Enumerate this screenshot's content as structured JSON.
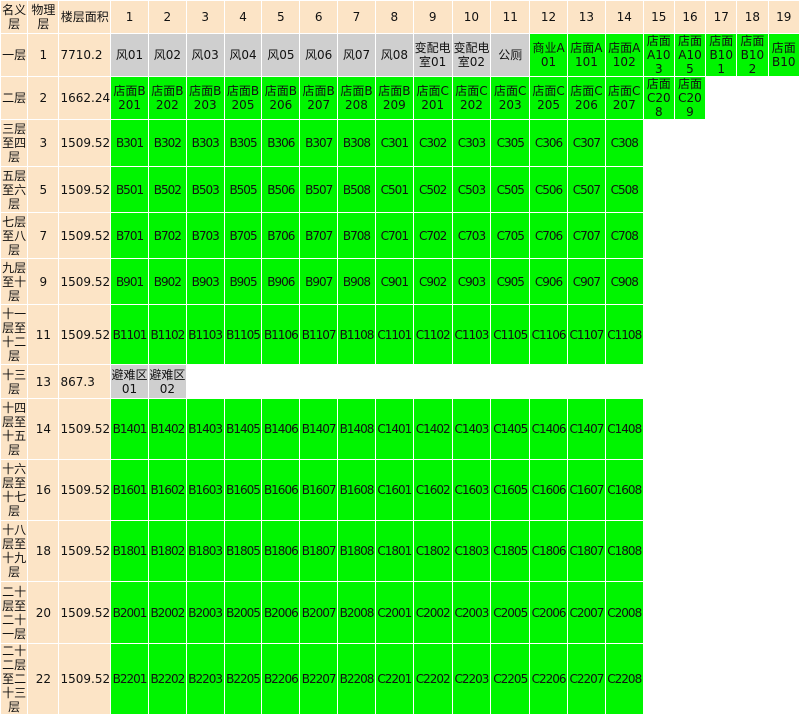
{
  "headers": {
    "c0": "名义层",
    "c1": "物理层",
    "c2": "楼层面积",
    "nums": [
      "1",
      "2",
      "3",
      "4",
      "5",
      "6",
      "7",
      "8",
      "9",
      "10",
      "11",
      "12",
      "13",
      "14",
      "15",
      "16",
      "17",
      "18",
      "19"
    ]
  },
  "rows": [
    {
      "name": "一层",
      "phys": "1",
      "area": "7710.2",
      "cells": [
        {
          "t": "风01",
          "c": "s"
        },
        {
          "t": "风02",
          "c": "s"
        },
        {
          "t": "风03",
          "c": "s"
        },
        {
          "t": "风04",
          "c": "s"
        },
        {
          "t": "风05",
          "c": "s"
        },
        {
          "t": "风06",
          "c": "s"
        },
        {
          "t": "风07",
          "c": "s"
        },
        {
          "t": "风08",
          "c": "s"
        },
        {
          "t": "变配电室01",
          "c": "s"
        },
        {
          "t": "变配电室02",
          "c": "s"
        },
        {
          "t": "公厕",
          "c": "s"
        },
        {
          "t": "商业A01",
          "c": "g"
        },
        {
          "t": "店面A101",
          "c": "g"
        },
        {
          "t": "店面A102",
          "c": "g"
        },
        {
          "t": "店面A103",
          "c": "g"
        },
        {
          "t": "店面A105",
          "c": "g"
        },
        {
          "t": "店面B101",
          "c": "g"
        },
        {
          "t": "店面B102",
          "c": "g"
        },
        {
          "t": "店面B10",
          "c": "g"
        }
      ]
    },
    {
      "name": "二层",
      "phys": "2",
      "area": "1662.24",
      "cells": [
        {
          "t": "店面B201",
          "c": "g"
        },
        {
          "t": "店面B202",
          "c": "g"
        },
        {
          "t": "店面B203",
          "c": "g"
        },
        {
          "t": "店面B205",
          "c": "g"
        },
        {
          "t": "店面B206",
          "c": "g"
        },
        {
          "t": "店面B207",
          "c": "g"
        },
        {
          "t": "店面B208",
          "c": "g"
        },
        {
          "t": "店面B209",
          "c": "g"
        },
        {
          "t": "店面C201",
          "c": "g"
        },
        {
          "t": "店面C202",
          "c": "g"
        },
        {
          "t": "店面C203",
          "c": "g"
        },
        {
          "t": "店面C205",
          "c": "g"
        },
        {
          "t": "店面C206",
          "c": "g"
        },
        {
          "t": "店面C207",
          "c": "g"
        },
        {
          "t": "店面C208",
          "c": "g"
        },
        {
          "t": "店面C209",
          "c": "g"
        },
        {
          "t": "",
          "c": "w"
        },
        {
          "t": "",
          "c": "w"
        },
        {
          "t": "",
          "c": "w"
        }
      ]
    },
    {
      "name": "三层至四层",
      "phys": "3",
      "area": "1509.52",
      "cells": [
        "B301",
        "B302",
        "B303",
        "B305",
        "B306",
        "B307",
        "B308",
        "C301",
        "C302",
        "C303",
        "C305",
        "C306",
        "C307",
        "C308"
      ]
    },
    {
      "name": "五层至六层",
      "phys": "5",
      "area": "1509.52",
      "cells": [
        "B501",
        "B502",
        "B503",
        "B505",
        "B506",
        "B507",
        "B508",
        "C501",
        "C502",
        "C503",
        "C505",
        "C506",
        "C507",
        "C508"
      ]
    },
    {
      "name": "七层至八层",
      "phys": "7",
      "area": "1509.52",
      "cells": [
        "B701",
        "B702",
        "B703",
        "B705",
        "B706",
        "B707",
        "B708",
        "C701",
        "C702",
        "C703",
        "C705",
        "C706",
        "C707",
        "C708"
      ]
    },
    {
      "name": "九层至十层",
      "phys": "9",
      "area": "1509.52",
      "cells": [
        "B901",
        "B902",
        "B903",
        "B905",
        "B906",
        "B907",
        "B908",
        "C901",
        "C902",
        "C903",
        "C905",
        "C906",
        "C907",
        "C908"
      ]
    },
    {
      "name": "十一层至十二层",
      "phys": "11",
      "area": "1509.52",
      "cells": [
        "B1101",
        "B1102",
        "B1103",
        "B1105",
        "B1106",
        "B1107",
        "B1108",
        "C1101",
        "C1102",
        "C1103",
        "C1105",
        "C1106",
        "C1107",
        "C1108"
      ]
    },
    {
      "name": "十三层",
      "phys": "13",
      "area": "867.3",
      "cells": [
        {
          "t": "避难区01",
          "c": "s"
        },
        {
          "t": "避难区02",
          "c": "s"
        }
      ]
    },
    {
      "name": "十四层至十五层",
      "phys": "14",
      "area": "1509.52",
      "cells": [
        "B1401",
        "B1402",
        "B1403",
        "B1405",
        "B1406",
        "B1407",
        "B1408",
        "C1401",
        "C1402",
        "C1403",
        "C1405",
        "C1406",
        "C1407",
        "C1408"
      ]
    },
    {
      "name": "十六层至十七层",
      "phys": "16",
      "area": "1509.52",
      "cells": [
        "B1601",
        "B1602",
        "B1603",
        "B1605",
        "B1606",
        "B1607",
        "B1608",
        "C1601",
        "C1602",
        "C1603",
        "C1605",
        "C1606",
        "C1607",
        "C1608"
      ]
    },
    {
      "name": "十八层至十九层",
      "phys": "18",
      "area": "1509.52",
      "cells": [
        "B1801",
        "B1802",
        "B1803",
        "B1805",
        "B1806",
        "B1807",
        "B1808",
        "C1801",
        "C1802",
        "C1803",
        "C1805",
        "C1806",
        "C1807",
        "C1808"
      ]
    },
    {
      "name": "二十层至二十一层",
      "phys": "20",
      "area": "1509.52",
      "cells": [
        "B2001",
        "B2002",
        "B2003",
        "B2005",
        "B2006",
        "B2007",
        "B2008",
        "C2001",
        "C2002",
        "C2003",
        "C2005",
        "C2006",
        "C2007",
        "C2008"
      ]
    },
    {
      "name": "二十二层至二十三层",
      "phys": "22",
      "area": "1509.52",
      "cells": [
        "B2201",
        "B2202",
        "B2203",
        "B2205",
        "B2206",
        "B2207",
        "B2208",
        "C2201",
        "C2202",
        "C2203",
        "C2205",
        "C2206",
        "C2207",
        "C2208"
      ]
    }
  ],
  "colors": {
    "header": "#fce4c6",
    "available": "#00f500",
    "service": "#cfcfcf"
  }
}
